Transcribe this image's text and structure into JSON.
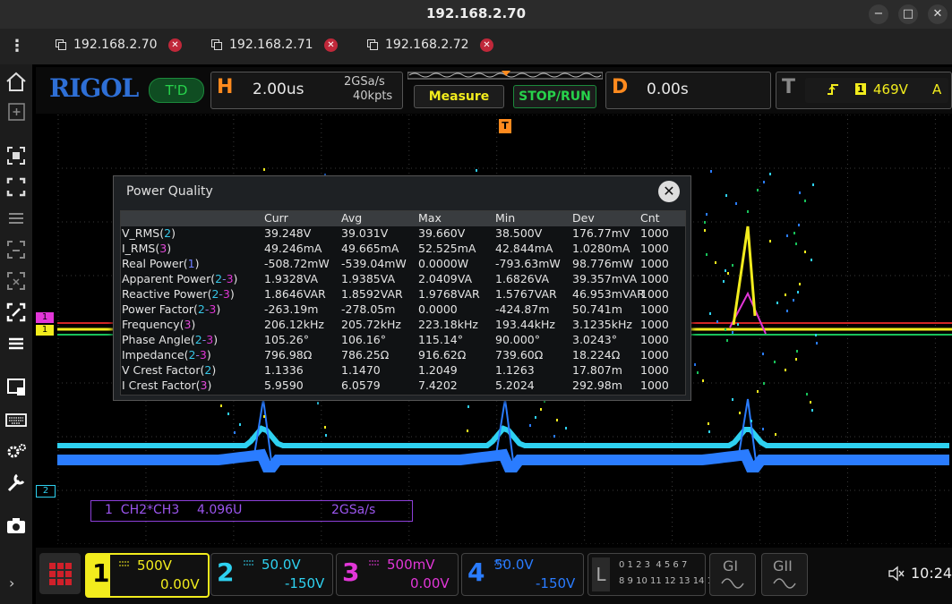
{
  "window": {
    "title": "192.168.2.70",
    "min": "−",
    "max": "□",
    "close": "✕"
  },
  "tabs": [
    {
      "label": "192.168.2.70",
      "active": true
    },
    {
      "label": "192.168.2.71",
      "active": false
    },
    {
      "label": "192.168.2.72",
      "active": false
    }
  ],
  "toolbar": {
    "brand": "RIGOL",
    "td": "T'D",
    "h_letter": "H",
    "timebase": "2.00us",
    "sample_rate": "2GSa/s",
    "mem_depth": "40kpts",
    "measure": "Measure",
    "stop_run": "STOP/RUN",
    "d_letter": "D",
    "delay": "0.00s",
    "t_letter": "T",
    "trig_channel": "1",
    "trig_level": "469V",
    "trig_mode": "A"
  },
  "markers": {
    "ch1": "1",
    "ch2": "2",
    "trig_pos": "T"
  },
  "dialog": {
    "title": "Power Quality",
    "close": "✕",
    "columns": [
      "Curr",
      "Avg",
      "Max",
      "Min",
      "Dev",
      "Cnt"
    ],
    "rows": [
      {
        "name": "V_RMS",
        "src": "2",
        "src_class": "c2",
        "values": [
          "39.248V",
          "39.031V",
          "39.660V",
          "38.500V",
          "176.77mV",
          "1000"
        ]
      },
      {
        "name": "I_RMS",
        "src": "3",
        "src_class": "c3",
        "values": [
          "49.246mA",
          "49.665mA",
          "52.525mA",
          "42.844mA",
          "1.0280mA",
          "1000"
        ]
      },
      {
        "name": "Real Power",
        "src": "1",
        "src_class": "c1",
        "values": [
          "-508.72mW",
          "-539.04mW",
          "0.0000W",
          "-793.63mW",
          "98.776mW",
          "1000"
        ]
      },
      {
        "name": "Apparent Power",
        "src": "2-3",
        "src_class": "mix",
        "values": [
          "1.9328VA",
          "1.9385VA",
          "2.0409VA",
          "1.6826VA",
          "39.357mVA",
          "1000"
        ]
      },
      {
        "name": "Reactive Power",
        "src": "2-3",
        "src_class": "mix",
        "values": [
          "1.8646VAR",
          "1.8592VAR",
          "1.9768VAR",
          "1.5767VAR",
          "46.953mVAR",
          "1000"
        ]
      },
      {
        "name": "Power Factor",
        "src": "2-3",
        "src_class": "mix",
        "values": [
          "-263.19m",
          "-278.05m",
          "0.0000",
          "-424.87m",
          "50.741m",
          "1000"
        ]
      },
      {
        "name": "Frequency",
        "src": "3",
        "src_class": "c3",
        "values": [
          "206.12kHz",
          "205.72kHz",
          "223.18kHz",
          "193.44kHz",
          "3.1235kHz",
          "1000"
        ]
      },
      {
        "name": "Phase Angle",
        "src": "2-3",
        "src_class": "mix",
        "values": [
          "105.26°",
          "106.16°",
          "115.14°",
          "90.000°",
          "3.0243°",
          "1000"
        ]
      },
      {
        "name": "Impedance",
        "src": "2-3",
        "src_class": "mix",
        "values": [
          "796.98Ω",
          "786.25Ω",
          "916.62Ω",
          "739.60Ω",
          "18.224Ω",
          "1000"
        ]
      },
      {
        "name": "V Crest Factor",
        "src": "2",
        "src_class": "c2",
        "values": [
          "1.1336",
          "1.1470",
          "1.2049",
          "1.1263",
          "17.807m",
          "1000"
        ]
      },
      {
        "name": "I Crest Factor",
        "src": "3",
        "src_class": "c3",
        "values": [
          "5.9590",
          "6.0579",
          "7.4202",
          "5.2024",
          "292.98m",
          "1000"
        ]
      }
    ]
  },
  "math_label": {
    "text": "1  CH2*CH3",
    "value": "4.096U",
    "rate": "2GSa/s"
  },
  "channels": [
    {
      "num": "1",
      "scale": "500V",
      "offset": "0.00V",
      "color": "#f2ec1d"
    },
    {
      "num": "2",
      "scale": "50.0V",
      "offset": "-150V",
      "color": "#2ed1f0"
    },
    {
      "num": "3",
      "scale": "500mV",
      "offset": "0.00V",
      "color": "#e236d8"
    },
    {
      "num": "4",
      "scale": "50.0V",
      "offset": "-150V",
      "color": "#2a7cff"
    }
  ],
  "digital": {
    "letter": "L",
    "row1": "0 1 2 3  4 5 6 7",
    "row2": "8 9 10 11 12 13 14 15"
  },
  "gen": {
    "g1": "GI",
    "g2": "GII"
  },
  "status": {
    "time": "10:24"
  },
  "colors": {
    "ch1": "#f2ec1d",
    "ch2": "#2ed1f0",
    "ch3": "#e236d8",
    "ch4": "#2a7cff",
    "accent_orange": "#ff8a1e",
    "green": "#1dbb3a"
  }
}
